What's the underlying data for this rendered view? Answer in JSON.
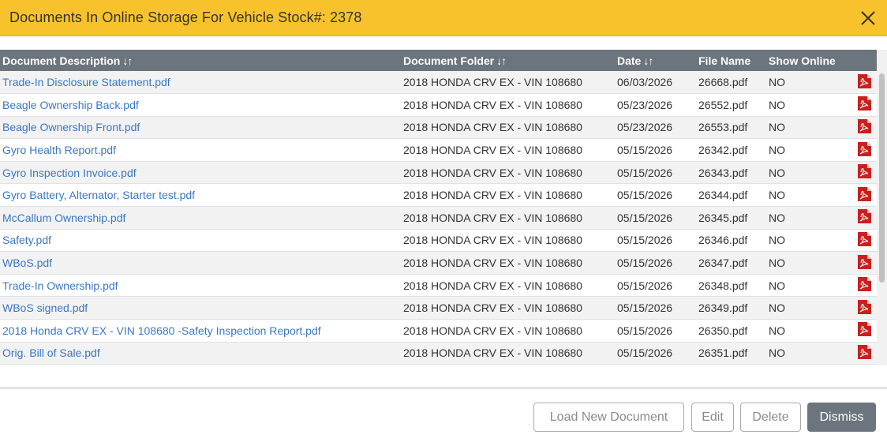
{
  "modal": {
    "title": "Documents In Online Storage For Vehicle Stock#: 2378"
  },
  "table": {
    "columns": [
      {
        "label": "Document Description",
        "sort": "↓↑"
      },
      {
        "label": "Document Folder",
        "sort": "↓↑"
      },
      {
        "label": "Date",
        "sort": "↓↑"
      },
      {
        "label": "File Name",
        "sort": ""
      },
      {
        "label": "Show Online",
        "sort": ""
      }
    ],
    "rows": [
      {
        "description": "Trade-In Disclosure Statement.pdf",
        "folder": "2018 HONDA CRV EX - VIN 108680",
        "date": "06/03/2026",
        "file": "26668.pdf",
        "online": "NO"
      },
      {
        "description": "Beagle Ownership Back.pdf",
        "folder": "2018 HONDA CRV EX - VIN 108680",
        "date": "05/23/2026",
        "file": "26552.pdf",
        "online": "NO"
      },
      {
        "description": "Beagle Ownership Front.pdf",
        "folder": "2018 HONDA CRV EX - VIN 108680",
        "date": "05/23/2026",
        "file": "26553.pdf",
        "online": "NO"
      },
      {
        "description": "Gyro Health Report.pdf",
        "folder": "2018 HONDA CRV EX - VIN 108680",
        "date": "05/15/2026",
        "file": "26342.pdf",
        "online": "NO"
      },
      {
        "description": "Gyro Inspection Invoice.pdf",
        "folder": "2018 HONDA CRV EX - VIN 108680",
        "date": "05/15/2026",
        "file": "26343.pdf",
        "online": "NO"
      },
      {
        "description": "Gyro Battery, Alternator, Starter test.pdf",
        "folder": "2018 HONDA CRV EX - VIN 108680",
        "date": "05/15/2026",
        "file": "26344.pdf",
        "online": "NO"
      },
      {
        "description": "McCallum Ownership.pdf",
        "folder": "2018 HONDA CRV EX - VIN 108680",
        "date": "05/15/2026",
        "file": "26345.pdf",
        "online": "NO"
      },
      {
        "description": "Safety.pdf",
        "folder": "2018 HONDA CRV EX - VIN 108680",
        "date": "05/15/2026",
        "file": "26346.pdf",
        "online": "NO"
      },
      {
        "description": "WBoS.pdf",
        "folder": "2018 HONDA CRV EX - VIN 108680",
        "date": "05/15/2026",
        "file": "26347.pdf",
        "online": "NO"
      },
      {
        "description": "Trade-In Ownership.pdf",
        "folder": "2018 HONDA CRV EX - VIN 108680",
        "date": "05/15/2026",
        "file": "26348.pdf",
        "online": "NO"
      },
      {
        "description": "WBoS signed.pdf",
        "folder": "2018 HONDA CRV EX - VIN 108680",
        "date": "05/15/2026",
        "file": "26349.pdf",
        "online": "NO"
      },
      {
        "description": "2018 Honda CRV EX - VIN 108680 -Safety Inspection Report.pdf",
        "folder": "2018 HONDA CRV EX - VIN 108680",
        "date": "05/15/2026",
        "file": "26350.pdf",
        "online": "NO"
      },
      {
        "description": "Orig. Bill of Sale.pdf",
        "folder": "2018 HONDA CRV EX - VIN 108680",
        "date": "05/15/2026",
        "file": "26351.pdf",
        "online": "NO"
      }
    ],
    "row_icon": "pdf-file-icon"
  },
  "footer": {
    "load_label": "Load New Document",
    "edit_label": "Edit",
    "delete_label": "Delete",
    "dismiss_label": "Dismiss"
  },
  "colors": {
    "header_bg": "#f8c22d",
    "table_header_bg": "#6c757d",
    "link": "#3a78c4",
    "pdf_red": "#c9201f"
  }
}
